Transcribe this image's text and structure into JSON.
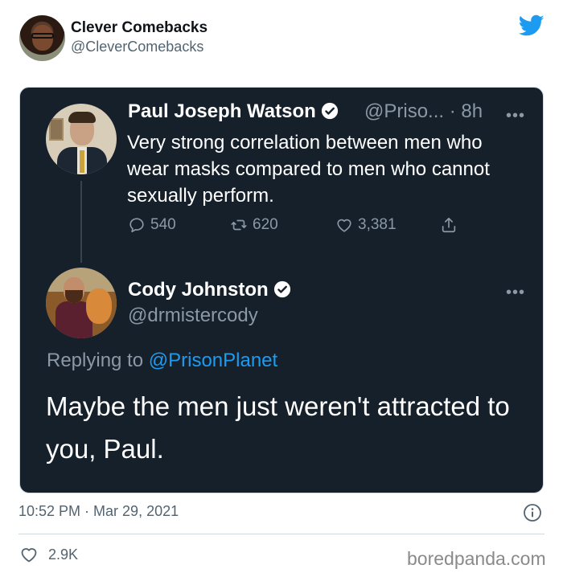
{
  "outer": {
    "name": "Clever Comebacks",
    "handle": "@CleverComebacks",
    "timestamp": "10:52 PM · Mar 29, 2021",
    "likes": "2.9K"
  },
  "quoted": {
    "tweet1": {
      "name": "Paul Joseph Watson",
      "meta": "@Priso... · 8h",
      "text": "Very strong correlation between men who wear masks compared to men who cannot sexually perform.",
      "replies": "540",
      "retweets": "620",
      "likes": "3,381"
    },
    "tweet2": {
      "name": "Cody Johnston",
      "handle": "@drmistercody",
      "replying_prefix": "Replying to ",
      "replying_to": "@PrisonPlanet",
      "text": "Maybe the men just weren't attracted to you, Paul."
    }
  },
  "watermark": "boredpanda.com",
  "colors": {
    "twitter_blue": "#1d9bf0",
    "dark_background": "#15202b"
  }
}
